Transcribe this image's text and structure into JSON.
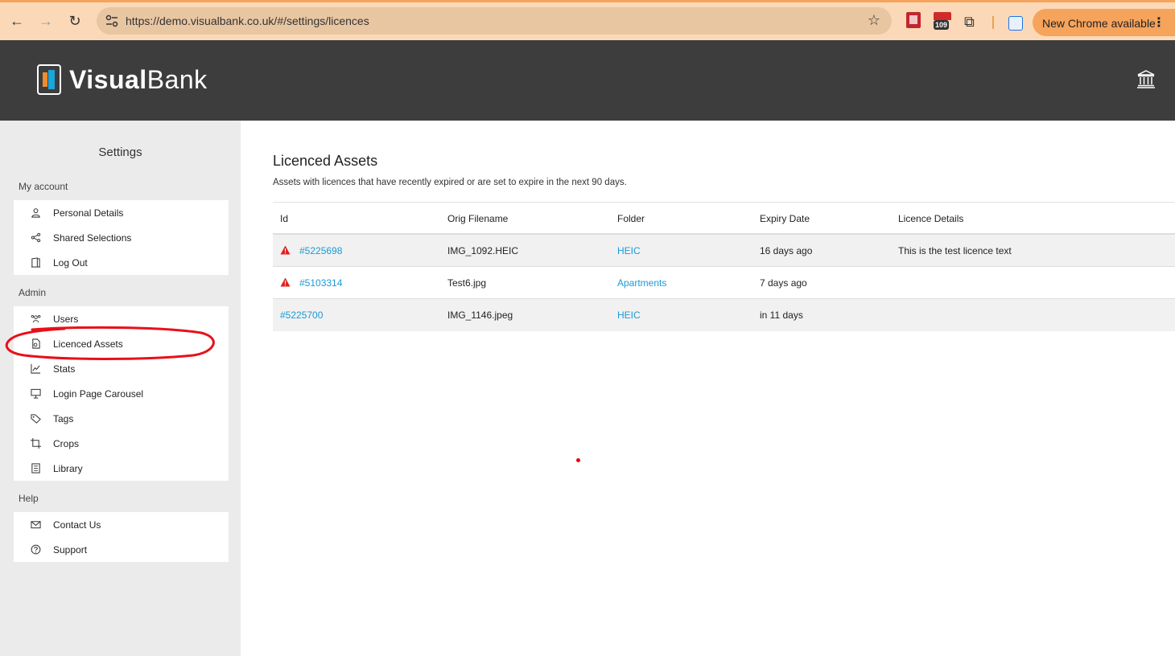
{
  "browser": {
    "url": "https://demo.visualbank.co.uk/#/settings/licences",
    "extension_badge": "109",
    "update_label": "New Chrome available"
  },
  "header": {
    "logo_bold": "Visual",
    "logo_light": "Bank"
  },
  "sidebar": {
    "title": "Settings",
    "sections": {
      "my_account": {
        "label": "My account",
        "items": [
          "Personal Details",
          "Shared Selections",
          "Log Out"
        ]
      },
      "admin": {
        "label": "Admin",
        "items": [
          "Users",
          "Licenced Assets",
          "Stats",
          "Login Page Carousel",
          "Tags",
          "Crops",
          "Library"
        ]
      },
      "help": {
        "label": "Help",
        "items": [
          "Contact Us",
          "Support"
        ]
      }
    }
  },
  "main": {
    "title": "Licenced Assets",
    "subtitle": "Assets with licences that have recently expired or are set to expire in the next 90 days.",
    "columns": [
      "Id",
      "Orig Filename",
      "Folder",
      "Expiry Date",
      "Licence Details"
    ],
    "rows": [
      {
        "id": "#5225698",
        "filename": "IMG_1092.HEIC",
        "folder": "HEIC",
        "expiry": "16 days ago",
        "details": "This is the test licence text",
        "warning": true
      },
      {
        "id": "#5103314",
        "filename": "Test6.jpg",
        "folder": "Apartments",
        "expiry": "7 days ago",
        "details": "",
        "warning": true
      },
      {
        "id": "#5225700",
        "filename": "IMG_1146.jpeg",
        "folder": "HEIC",
        "expiry": "in 11 days",
        "details": "",
        "warning": false
      }
    ]
  },
  "colors": {
    "accent": "#1a9ad6",
    "header_bg": "#3d3d3d",
    "sidebar_bg": "#ebebeb",
    "warning": "#e02020",
    "annotation": "#e8101a"
  }
}
